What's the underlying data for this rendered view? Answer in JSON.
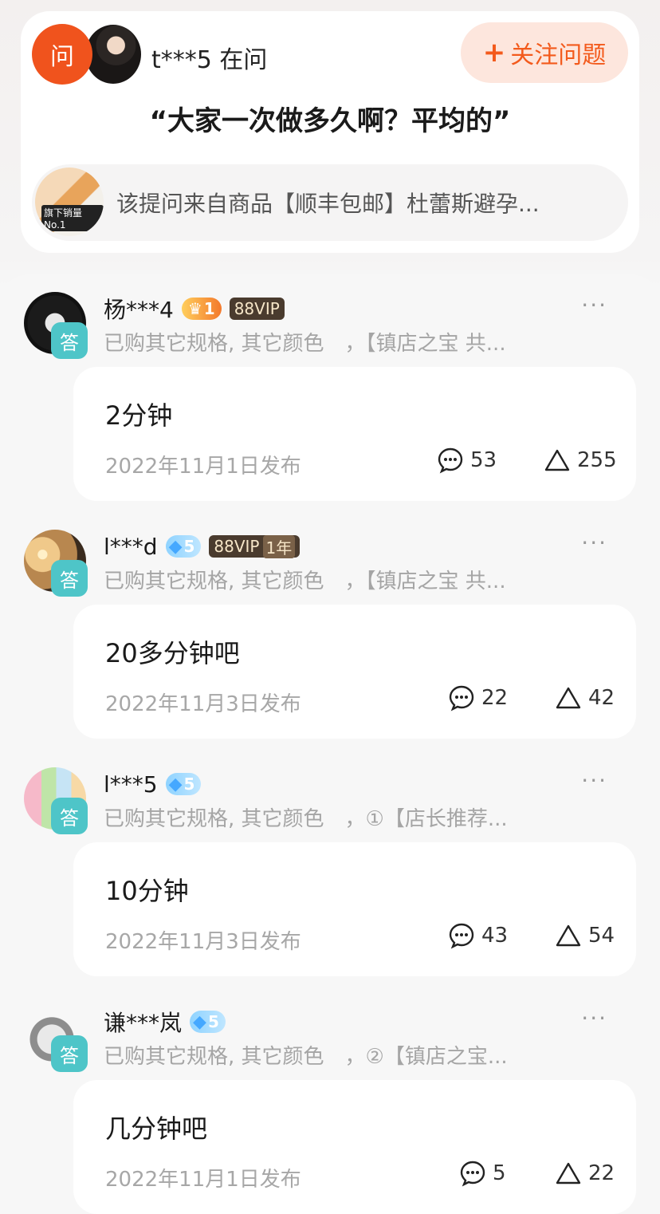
{
  "question": {
    "ask_badge": "问",
    "asker": "t***5 在问",
    "follow_label": "关注问题",
    "text": "“大家一次做多久啊？平均的”",
    "product_text": "该提问来自商品【顺丰包邮】杜蕾斯避孕...",
    "thumb_label": "旗下销量No.1"
  },
  "answer_badge": "答",
  "more_label": "···",
  "answers": [
    {
      "name": "杨***4",
      "level": "1",
      "vip": "88VIP",
      "vip_years": "",
      "spec": "已购其它规格, 其它颜色　，【镇店之宝 共...",
      "text": "2分钟",
      "date": "2022年11月1日发布",
      "comments": "53",
      "likes": "255"
    },
    {
      "name": "l***d",
      "level": "5",
      "vip": "88VIP",
      "vip_years": "1年",
      "spec": "已购其它规格, 其它颜色　，【镇店之宝 共...",
      "text": "20多分钟吧",
      "date": "2022年11月3日发布",
      "comments": "22",
      "likes": "42"
    },
    {
      "name": "l***5",
      "level": "5",
      "vip": "",
      "vip_years": "",
      "spec": "已购其它规格, 其它颜色　，①【店长推荐...",
      "text": "10分钟",
      "date": "2022年11月3日发布",
      "comments": "43",
      "likes": "54"
    },
    {
      "name": "谦***岚",
      "level": "5",
      "vip": "",
      "vip_years": "",
      "spec": "已购其它规格, 其它颜色　，②【镇店之宝...",
      "text": "几分钟吧",
      "date": "2022年11月1日发布",
      "comments": "5",
      "likes": "22"
    }
  ],
  "colors": {
    "accent_orange": "#f0531d",
    "follow_bg": "#fde6dd",
    "answer_badge": "#4ec5c8"
  }
}
